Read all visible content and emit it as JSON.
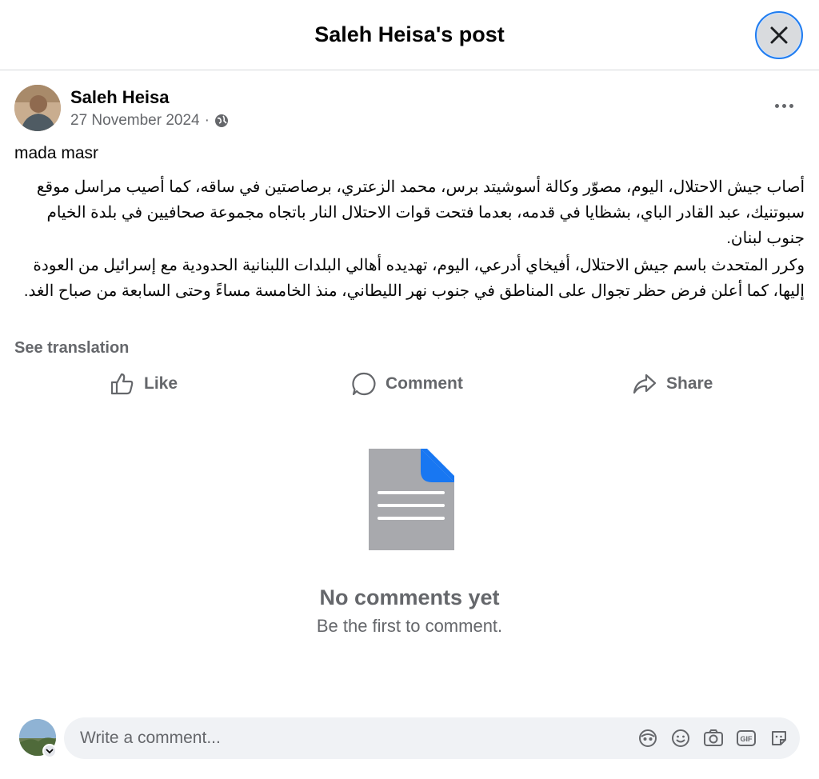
{
  "header": {
    "title": "Saleh Heisa's post"
  },
  "post": {
    "author": "Saleh Heisa",
    "date": "27 November 2024",
    "separator": "·",
    "intro": "mada masr",
    "paragraphs": [
      "أصاب جيش الاحتلال، اليوم، مصوّر وكالة أسوشيتد برس، محمد الزعتري، برصاصتين في ساقه، كما أصيب مراسل موقع سبوتنيك، عبد القادر الباي، بشظايا في قدمه، بعدما فتحت قوات الاحتلال النار باتجاه مجموعة صحافيين في بلدة الخيام جنوب لبنان.",
      "وكرر المتحدث باسم جيش الاحتلال، أفيخاي أدرعي، اليوم، تهديده أهالي البلدات اللبنانية الحدودية مع إسرائيل من العودة إليها، كما أعلن فرض حظر تجوال على المناطق في جنوب نهر الليطاني، منذ الخامسة مساءً وحتى السابعة من صباح الغد."
    ],
    "see_translation": "See translation"
  },
  "actions": {
    "like": "Like",
    "comment": "Comment",
    "share": "Share"
  },
  "empty_state": {
    "title": "No comments yet",
    "subtitle": "Be the first to comment."
  },
  "composer": {
    "placeholder": "Write a comment...",
    "tools": [
      "avatar-sticker-icon",
      "emoji-icon",
      "camera-icon",
      "gif-icon",
      "sticker-icon"
    ]
  },
  "colors": {
    "accent": "#1877f2",
    "muted": "#65676b",
    "doc_gray": "#a8a9ad"
  }
}
